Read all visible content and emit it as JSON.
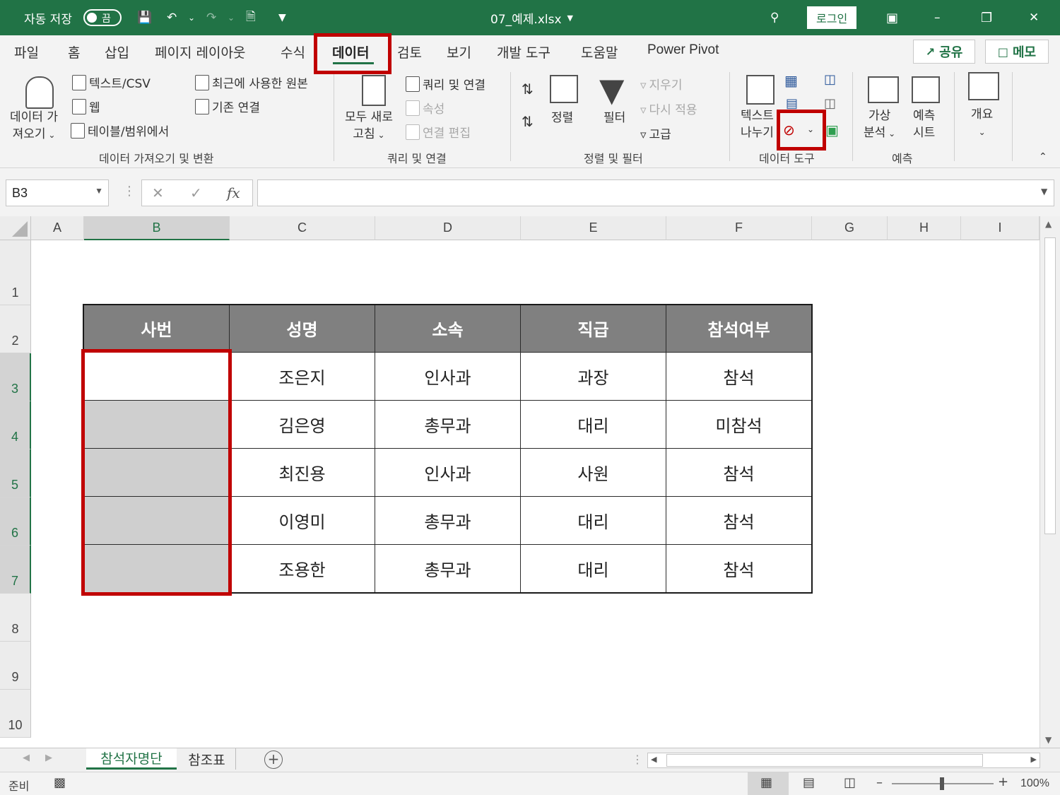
{
  "titlebar": {
    "autosave_label": "자동 저장",
    "autosave_state": "끔",
    "filename": "07_예제.xlsx",
    "login_label": "로그인"
  },
  "tabs": [
    "파일",
    "홈",
    "삽입",
    "페이지 레이아웃",
    "수식",
    "데이터",
    "검토",
    "보기",
    "개발 도구",
    "도움말",
    "Power Pivot"
  ],
  "active_tab": "데이터",
  "share_label": "공유",
  "memo_label": "메모",
  "ribbon": {
    "get_data": {
      "big_label_1": "데이터 가",
      "big_label_2": "져오기",
      "text_csv": "텍스트/CSV",
      "web": "웹",
      "table_range": "테이블/범위에서",
      "recent_sources": "최근에 사용한 원본",
      "existing_connections": "기존 연결",
      "group": "데이터 가져오기 및 변환"
    },
    "queries": {
      "refresh_1": "모두 새로",
      "refresh_2": "고침",
      "queries_connections": "쿼리 및 연결",
      "properties": "속성",
      "edit_links": "연결 편집",
      "group": "쿼리 및 연결"
    },
    "sort_filter": {
      "sort": "정렬",
      "filter": "필터",
      "clear": "지우기",
      "reapply": "다시 적용",
      "advanced": "고급",
      "group": "정렬 및 필터"
    },
    "data_tools": {
      "text_to_columns_1": "텍스트",
      "text_to_columns_2": "나누기",
      "group": "데이터 도구"
    },
    "forecast": {
      "whatif_1": "가상",
      "whatif_2": "분석",
      "sheet_1": "예측",
      "sheet_2": "시트",
      "group": "예측"
    },
    "outline": {
      "label": "개요"
    }
  },
  "namebox": "B3",
  "columns": [
    "A",
    "B",
    "C",
    "D",
    "E",
    "F",
    "G",
    "H",
    "I"
  ],
  "rows": [
    "1",
    "2",
    "3",
    "4",
    "5",
    "6",
    "7",
    "8",
    "9",
    "10"
  ],
  "table": {
    "headers": [
      "사번",
      "성명",
      "소속",
      "직급",
      "참석여부"
    ],
    "rows": [
      [
        "",
        "조은지",
        "인사과",
        "과장",
        "참석"
      ],
      [
        "",
        "김은영",
        "총무과",
        "대리",
        "미참석"
      ],
      [
        "",
        "최진용",
        "인사과",
        "사원",
        "참석"
      ],
      [
        "",
        "이영미",
        "총무과",
        "대리",
        "참석"
      ],
      [
        "",
        "조용한",
        "총무과",
        "대리",
        "참석"
      ]
    ]
  },
  "sheets": [
    "참석자명단",
    "참조표"
  ],
  "active_sheet": "참석자명단",
  "status": {
    "ready": "준비",
    "zoom": "100%"
  },
  "colors": {
    "excel_green": "#217346",
    "highlight_red": "#c00000",
    "header_gray": "#808080",
    "cell_gray": "#cfcfcf"
  }
}
